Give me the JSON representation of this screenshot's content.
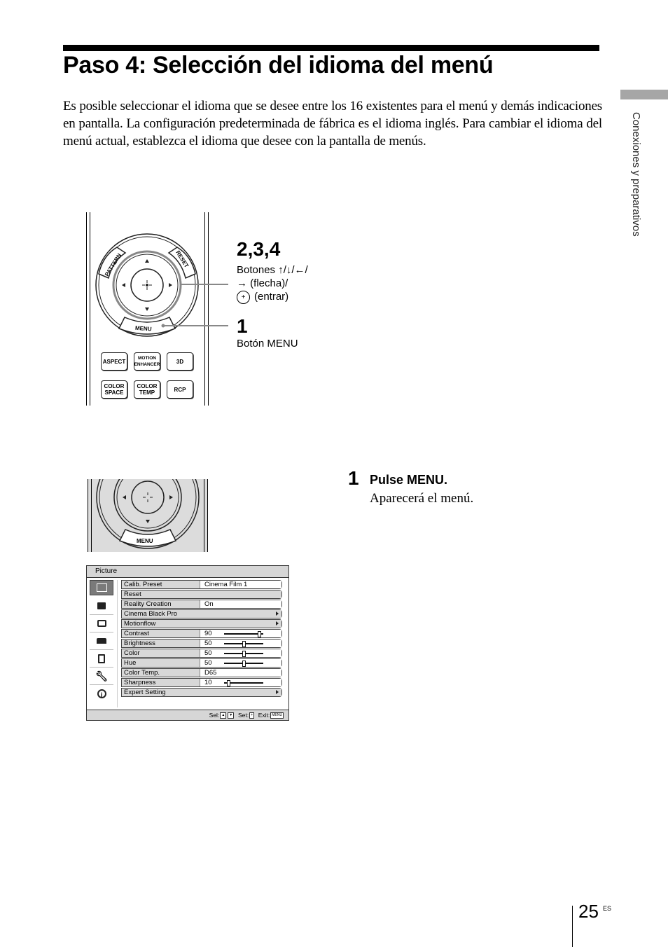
{
  "page": {
    "title": "Paso 4: Selección del idioma del menú",
    "intro": "Es posible seleccionar el idioma que se desee entre los 16 existentes para el menú y demás indicaciones en pantalla. La configuración predeterminada de fábrica es el idioma inglés. Para cambiar el idioma del menú actual, establezca el idioma que desee con la pantalla de menús.",
    "side_section": "Conexiones y preparativos",
    "page_number": "25",
    "page_lang": "ES"
  },
  "remote": {
    "pattern": "PATTERN",
    "reset": "RESET",
    "menu": "MENU",
    "buttons": [
      {
        "label": "ASPECT"
      },
      {
        "label": "MOTION ENHANCER"
      },
      {
        "label": "3D"
      },
      {
        "label": "COLOR SPACE"
      },
      {
        "label": "COLOR TEMP"
      },
      {
        "label": "RCP"
      }
    ],
    "callouts": [
      {
        "number": "2,3,4",
        "line1": "Botones ↑/↓/←/",
        "line2": "→ (flecha)/",
        "line3": "(entrar)"
      },
      {
        "number": "1",
        "line1": "Botón  MENU"
      }
    ]
  },
  "steps": [
    {
      "number": "1",
      "title": "Pulse MENU.",
      "description": "Aparecerá el menú."
    }
  ],
  "osd": {
    "header": "Picture",
    "icons": [
      "picture-icon",
      "picture-advanced-icon",
      "screen-icon",
      "setup-icon",
      "function-icon",
      "installation-icon",
      "information-icon"
    ],
    "rows": [
      {
        "label": "Calib. Preset",
        "value": "Cinema Film 1"
      },
      {
        "label": "Reset",
        "value": ""
      },
      {
        "label": "Reality Creation",
        "value": "On"
      },
      {
        "label": "Cinema Black Pro",
        "value": "",
        "submenu": true
      },
      {
        "label": "Motionflow",
        "value": "",
        "submenu": true
      },
      {
        "label": "Contrast",
        "value": "90",
        "slider": 0.9
      },
      {
        "label": "Brightness",
        "value": "50",
        "slider": 0.5
      },
      {
        "label": "Color",
        "value": "50",
        "slider": 0.5
      },
      {
        "label": "Hue",
        "value": "50",
        "slider": 0.5
      },
      {
        "label": "Color Temp.",
        "value": "D65"
      },
      {
        "label": "Sharpness",
        "value": "10",
        "slider": 0.1
      },
      {
        "label": "Expert Setting",
        "value": "",
        "submenu": true
      }
    ],
    "footer": {
      "sel": "Sel:",
      "set": "Set:",
      "exit": "Exit:",
      "exit_key": "MENU"
    }
  }
}
